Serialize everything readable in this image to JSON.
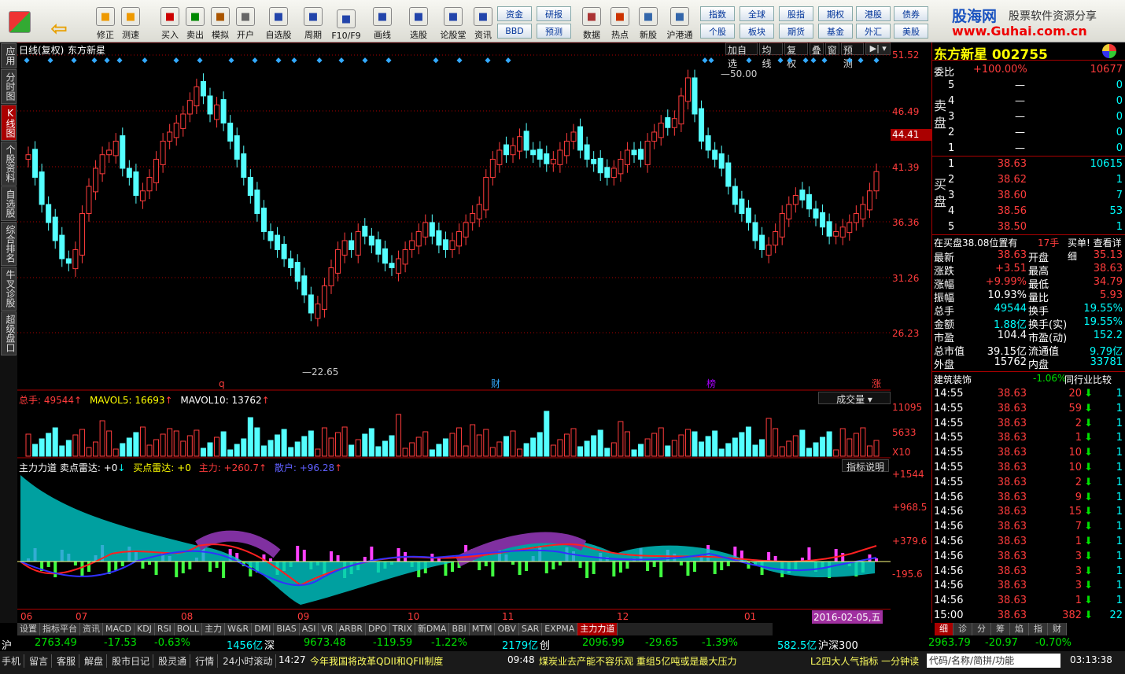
{
  "toolbar": {
    "buttons": [
      "修正",
      "测速",
      "买入",
      "卖出",
      "模拟",
      "开户",
      "自选股",
      "周期",
      "F10/F9",
      "画线",
      "选股",
      "论股堂",
      "资讯",
      "数据",
      "热点",
      "新股",
      "沪港通"
    ],
    "small": [
      "资金",
      "研报",
      "指数",
      "全球",
      "股指",
      "期权",
      "港股",
      "债券",
      "BBD",
      "预测",
      "个股",
      "板块",
      "期货",
      "基金",
      "外汇",
      "美股"
    ]
  },
  "logo": {
    "title": "股海网",
    "sub": "股票软件资源分享",
    "url": "www.Guhai.com.cn"
  },
  "lefttabs": [
    "应用",
    "分时图",
    "K线图",
    "个股资料",
    "自选股",
    "综合排名",
    "牛叉诊股",
    "超级盘口"
  ],
  "chart": {
    "period": "日线(复权)",
    "name": "东方新星",
    "tools": [
      "加自选",
      "均线",
      "复权",
      "叠",
      "窗",
      "预测"
    ],
    "hi_label": "50.00",
    "lo_label": "22.65",
    "marks": [
      "q",
      "财",
      "榜",
      "涨"
    ],
    "vol_label": "总手: 49544",
    "mavol5": "MAVOL5: 16693",
    "mavol10": "MAVOL10: 13762",
    "vol_select": "成交量",
    "ind_name": "主力力道",
    "ind_a": "卖点雷达: +0",
    "ind_b": "买点雷达: +0",
    "ind_main": "主力: +260.7",
    "ind_retail": "散户: +96.28",
    "ind_help": "指标说明",
    "dates": [
      "06",
      "07",
      "08",
      "09",
      "10",
      "11",
      "12",
      "01"
    ],
    "date_cur": "2016-02-05,五"
  },
  "axis": {
    "price": [
      "51.52",
      "46.49",
      "41.39",
      "36.36",
      "31.26",
      "26.23"
    ],
    "cur": "44.41",
    "vol": [
      "11095",
      "5633",
      "X10"
    ],
    "ind": [
      "+1544",
      "+968.5",
      "+379.6",
      "-195.6"
    ]
  },
  "quote": {
    "title": "东方新星 002755",
    "weibi_l": "委比",
    "weibi": "+100.00%",
    "weicha": "10677",
    "sell": [
      [
        "5",
        "—",
        "0"
      ],
      [
        "4",
        "—",
        "0"
      ],
      [
        "3",
        "—",
        "0"
      ],
      [
        "2",
        "—",
        "0"
      ],
      [
        "1",
        "—",
        "0"
      ]
    ],
    "buy": [
      [
        "1",
        "38.63",
        "10615"
      ],
      [
        "2",
        "38.62",
        "1"
      ],
      [
        "3",
        "38.60",
        "7"
      ],
      [
        "4",
        "38.56",
        "53"
      ],
      [
        "5",
        "38.50",
        "1"
      ]
    ],
    "info": "在买盘38.08位置有",
    "info2": "17手",
    "info3": "买单! 查看详细",
    "stats": [
      [
        "最新",
        "38.63",
        "开盘",
        "35.13"
      ],
      [
        "涨跌",
        "+3.51",
        "最高",
        "38.63"
      ],
      [
        "涨幅",
        "+9.99%",
        "最低",
        "34.79"
      ],
      [
        "振幅",
        "10.93%",
        "量比",
        "5.93"
      ],
      [
        "总手",
        "49544",
        "换手",
        "19.55%"
      ],
      [
        "金额",
        "1.88亿",
        "换手(实)",
        "19.55%"
      ],
      [
        "市盈",
        "104.4",
        "市盈(动)",
        "152.2"
      ],
      [
        "总市值",
        "39.15亿",
        "流通值",
        "9.79亿"
      ],
      [
        "外盘",
        "15762",
        "内盘",
        "33781"
      ]
    ],
    "sector": "建筑装饰",
    "sector_pct": "-1.06%",
    "sector_cmp": "同行业比较",
    "ticks": [
      [
        "14:55",
        "38.63",
        "20",
        "1"
      ],
      [
        "14:55",
        "38.63",
        "59",
        "1"
      ],
      [
        "14:55",
        "38.63",
        "2",
        "1"
      ],
      [
        "14:55",
        "38.63",
        "1",
        "1"
      ],
      [
        "14:55",
        "38.63",
        "10",
        "1"
      ],
      [
        "14:55",
        "38.63",
        "10",
        "1"
      ],
      [
        "14:55",
        "38.63",
        "2",
        "1"
      ],
      [
        "14:56",
        "38.63",
        "9",
        "1"
      ],
      [
        "14:56",
        "38.63",
        "15",
        "1"
      ],
      [
        "14:56",
        "38.63",
        "7",
        "1"
      ],
      [
        "14:56",
        "38.63",
        "1",
        "1"
      ],
      [
        "14:56",
        "38.63",
        "3",
        "1"
      ],
      [
        "14:56",
        "38.63",
        "3",
        "1"
      ],
      [
        "14:56",
        "38.63",
        "3",
        "1"
      ],
      [
        "14:56",
        "38.63",
        "1",
        "1"
      ],
      [
        "15:00",
        "38.63",
        "382",
        "22"
      ]
    ]
  },
  "idxtabs": [
    "设置",
    "指标平台",
    "资讯",
    "MACD",
    "KDJ",
    "RSI",
    "BOLL",
    "主力",
    "W&R",
    "DMI",
    "BIAS",
    "ASI",
    "VR",
    "ARBR",
    "DPO",
    "TRIX",
    "新DMA",
    "BBI",
    "MTM",
    "OBV",
    "SAR",
    "EXPMA",
    "主力力道"
  ],
  "rtabs": [
    "细",
    "诊",
    "分",
    "筹",
    "焰",
    "指",
    "财"
  ],
  "status": {
    "sh": "沪",
    "sh_v": "2763.49",
    "sh_c": "-17.53",
    "sh_p": "-0.63%",
    "sh_a": "1456亿",
    "sz": "深",
    "sz_v": "9673.48",
    "sz_c": "-119.59",
    "sz_p": "-1.22%",
    "sz_a": "2179亿",
    "cy": "创",
    "cy_v": "2096.99",
    "cy_c": "-29.65",
    "cy_p": "-1.39%",
    "cy_a": "582.5亿",
    "hs": "沪深300",
    "hs_v": "2963.79",
    "hs_c": "-20.97",
    "hs_p": "-0.70%"
  },
  "bottom": {
    "items": [
      "手机",
      "留言",
      "客服",
      "解盘",
      "股市日记",
      "股灵通",
      "行情",
      "24小时滚动"
    ],
    "news1t": "14:27",
    "news1": "今年我国将改革QDII和QFII制度",
    "news2t": "09:48",
    "news2": "煤炭业去产能不容乐观 重组5亿吨或是最大压力",
    "news3": "L2四大人气指标 一分钟读",
    "search": "代码/名称/简拼/功能",
    "clock": "03:13:38"
  },
  "chart_data": {
    "type": "candlestick",
    "title": "东方新星 002755 日线(复权)",
    "close": [
      40.5,
      38,
      35,
      33,
      31,
      29,
      28.5,
      30,
      34,
      37,
      39,
      40.5,
      41,
      42,
      39,
      38,
      36,
      36.5,
      38,
      40,
      42,
      43,
      44,
      45,
      46.5,
      48,
      47,
      45,
      46,
      44,
      42,
      40,
      38,
      36,
      34,
      32,
      31,
      30,
      29,
      28,
      26.5,
      25,
      23,
      24,
      26,
      28,
      30,
      31,
      30,
      32,
      31.5,
      30.5,
      29.5,
      28.5,
      28,
      29,
      30,
      31,
      32,
      33,
      31.5,
      30.5,
      30,
      31,
      32,
      33,
      34,
      35,
      38,
      40,
      41,
      40.5,
      41.5,
      42.5,
      41,
      40.5,
      40,
      39.5,
      40,
      41,
      42,
      43,
      41,
      40,
      39.5,
      38.5,
      38,
      39,
      40,
      41,
      40.5,
      40,
      42,
      43,
      44,
      43.5,
      44.5,
      47,
      49,
      45,
      42,
      41,
      40,
      39,
      37,
      35,
      34,
      33,
      31,
      30,
      30.5,
      32,
      34,
      35,
      36,
      35.5,
      34.5,
      33.5,
      32.5,
      31.5,
      32,
      32.5,
      33,
      34,
      35,
      36.5,
      38.63
    ],
    "ylim": [
      22,
      52
    ],
    "high_marker": "50.00",
    "low_marker": "22.65"
  }
}
